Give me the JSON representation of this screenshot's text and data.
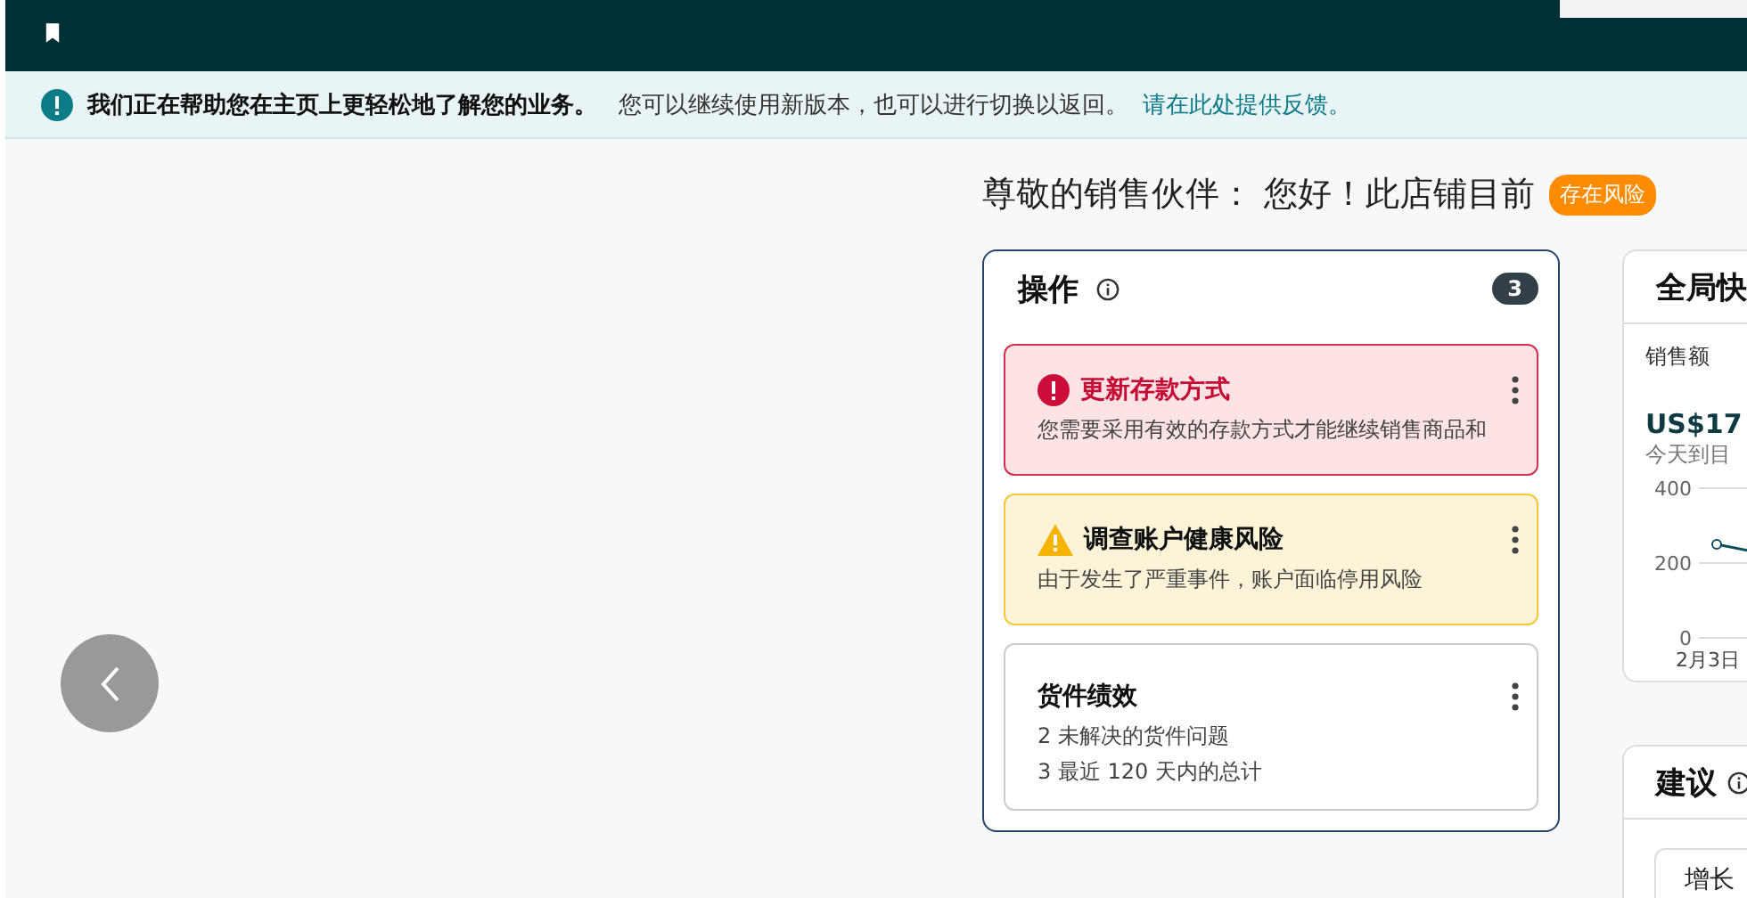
{
  "banner": {
    "bold": "我们正在帮助您在主页上更轻松地了解您的业务。",
    "text": "您可以继续使用新版本，也可以进行切换以返回。",
    "link": "请在此处提供反馈。"
  },
  "greeting": {
    "text": "尊敬的销售伙伴： 您好！此店铺目前",
    "badge": "存在风险"
  },
  "actions": {
    "title": "操作",
    "count": "3",
    "items": [
      {
        "kind": "error",
        "title": "更新存款方式",
        "lines": [
          "您需要采用有效的存款方式才能继续销售商品和"
        ]
      },
      {
        "kind": "warning",
        "title": "调查账户健康风险",
        "lines": [
          "由于发生了严重事件，账户面临停用风险"
        ]
      },
      {
        "kind": "plain",
        "title": "货件绩效",
        "lines": [
          "2  未解决的货件问题",
          "3  最近 120 天内的总计"
        ]
      }
    ]
  },
  "snapshot": {
    "title": "全局快",
    "metric_label": "销售额",
    "value": "US$17",
    "caption": "今天到目",
    "chart_data": {
      "type": "line",
      "categories": [
        "2月3日"
      ],
      "yticks": [
        0,
        200,
        400
      ],
      "ylim": [
        0,
        400
      ],
      "series": [
        {
          "color": "#0f4c5c",
          "marker": true,
          "values": [
            250
          ]
        }
      ]
    }
  },
  "suggestions": {
    "title": "建议",
    "item": "增长"
  }
}
